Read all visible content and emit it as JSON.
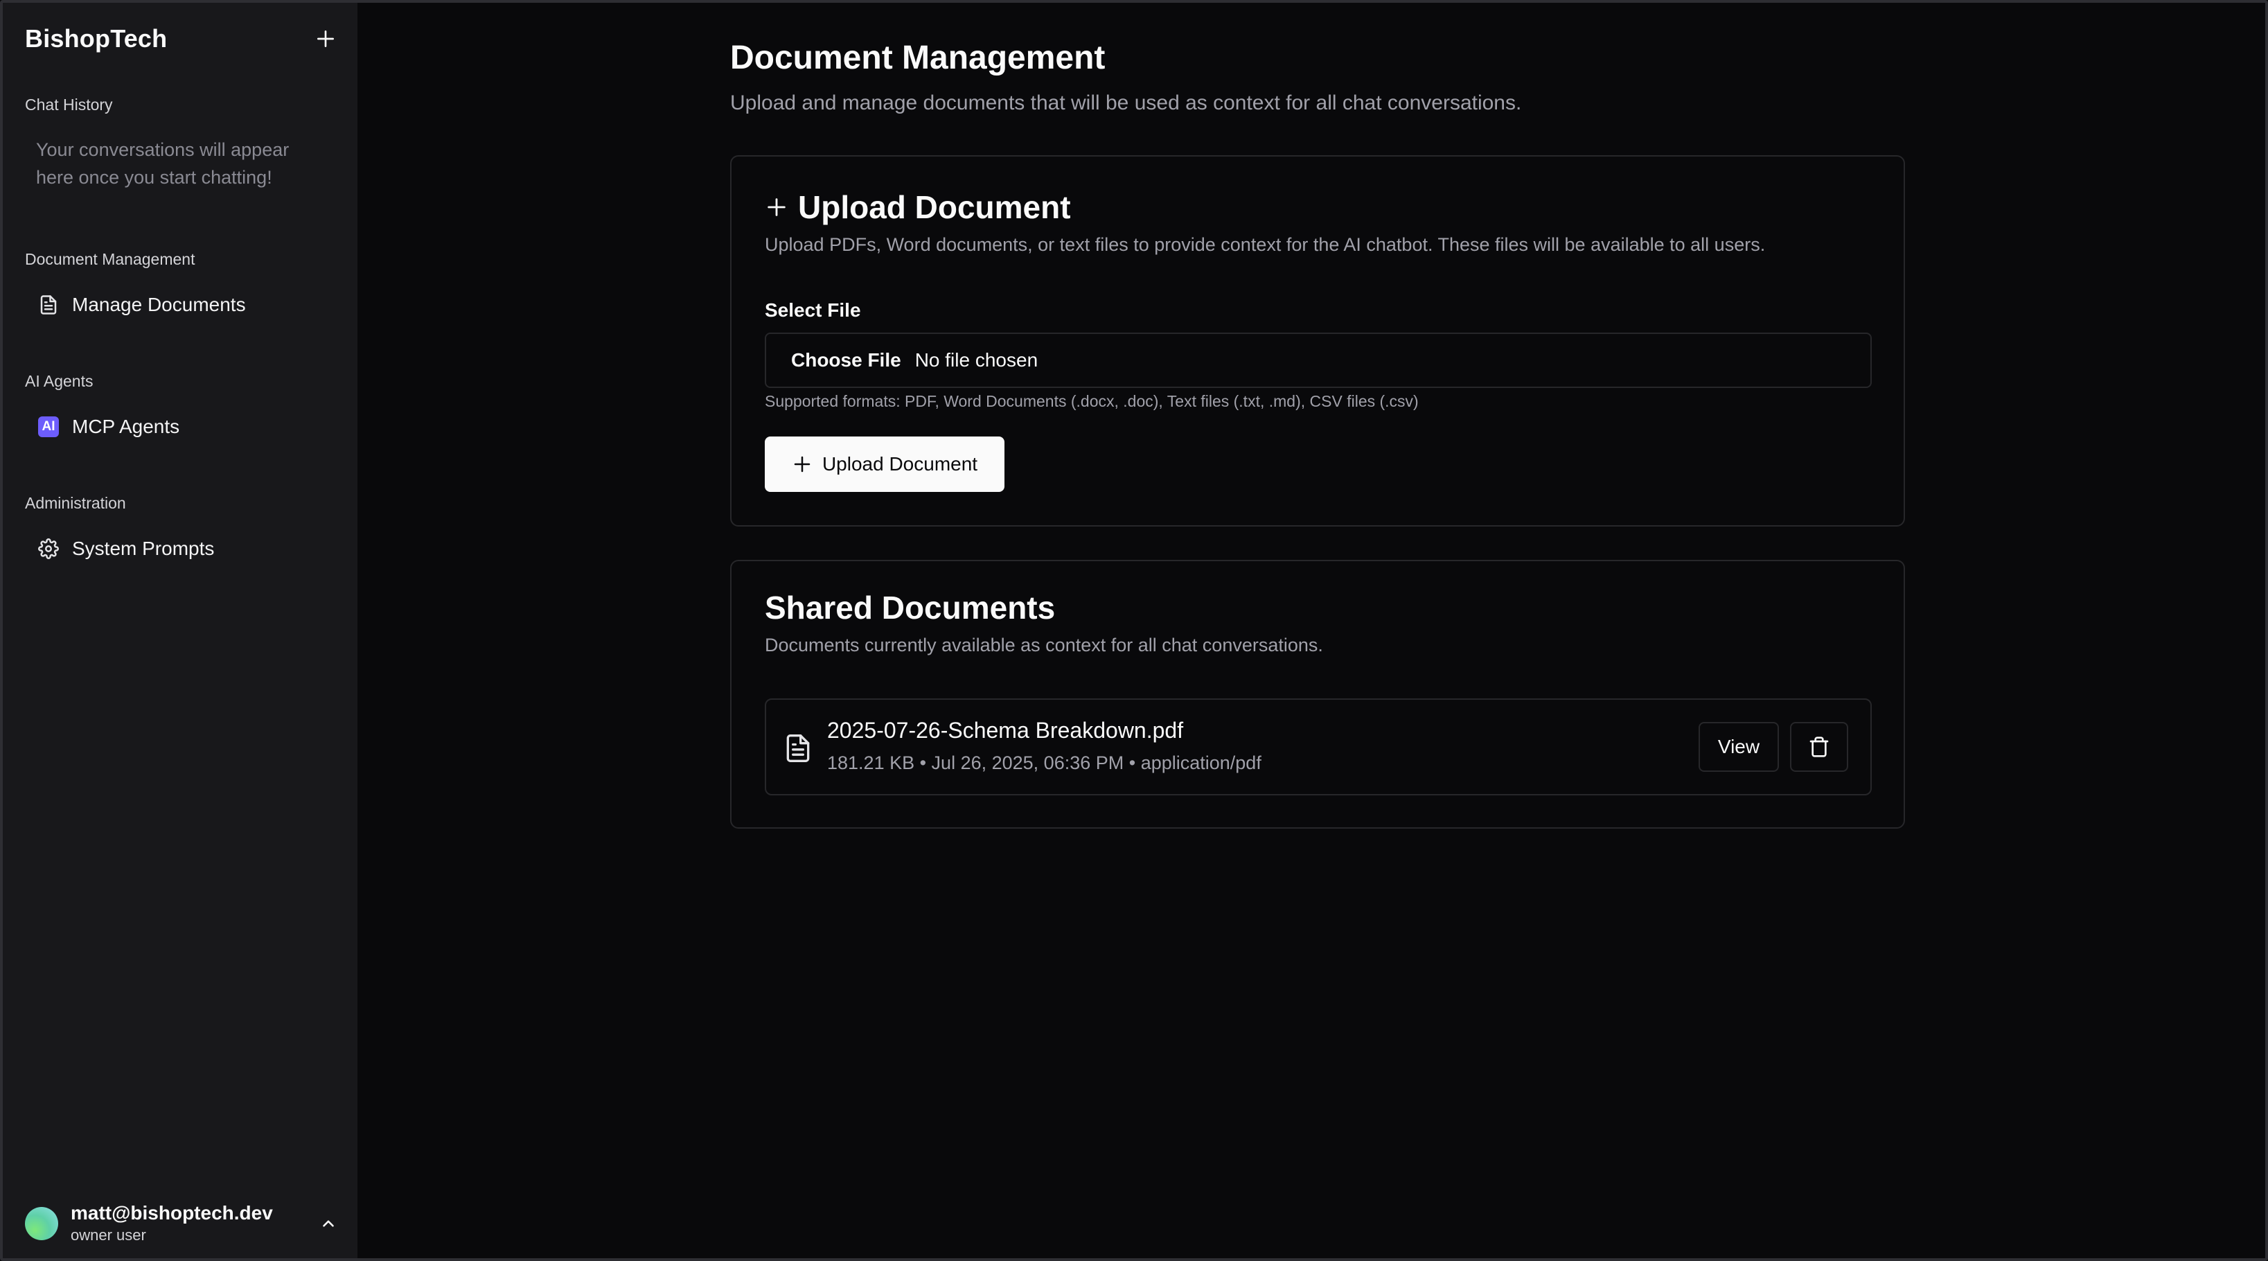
{
  "sidebar": {
    "brand": "BishopTech",
    "chat_history_label": "Chat History",
    "chat_history_empty": "Your conversations will appear here once you start chatting!",
    "groups": [
      {
        "label": "Document Management",
        "item": {
          "label": "Manage Documents",
          "icon": "file-text-icon"
        }
      },
      {
        "label": "AI Agents",
        "item": {
          "label": "MCP Agents",
          "icon": "ai-badge-icon",
          "badge_text": "AI"
        }
      },
      {
        "label": "Administration",
        "item": {
          "label": "System Prompts",
          "icon": "gear-icon"
        }
      }
    ],
    "user": {
      "email": "matt@bishoptech.dev",
      "role": "owner user"
    }
  },
  "main": {
    "title": "Document Management",
    "subtitle": "Upload and manage documents that will be used as context for all chat conversations.",
    "upload_card": {
      "title": "Upload Document",
      "description": "Upload PDFs, Word documents, or text files to provide context for the AI chatbot. These files will be available to all users.",
      "field_label": "Select File",
      "choose_label": "Choose File",
      "no_file_label": "No file chosen",
      "hint": "Supported formats: PDF, Word Documents (.docx, .doc), Text files (.txt, .md), CSV files (.csv)",
      "button_label": "Upload Document"
    },
    "shared_card": {
      "title": "Shared Documents",
      "description": "Documents currently available as context for all chat conversations.",
      "documents": [
        {
          "name": "2025-07-26-Schema Breakdown.pdf",
          "meta": "181.21 KB • Jul 26, 2025, 06:36 PM • application/pdf",
          "view_label": "View"
        }
      ]
    }
  },
  "colors": {
    "background": "#09090b",
    "sidebar": "#18181b",
    "border": "#27272a",
    "muted_text": "#a1a1aa",
    "accent_ai": "#6d5dfc",
    "primary_button": "#fafafa"
  }
}
